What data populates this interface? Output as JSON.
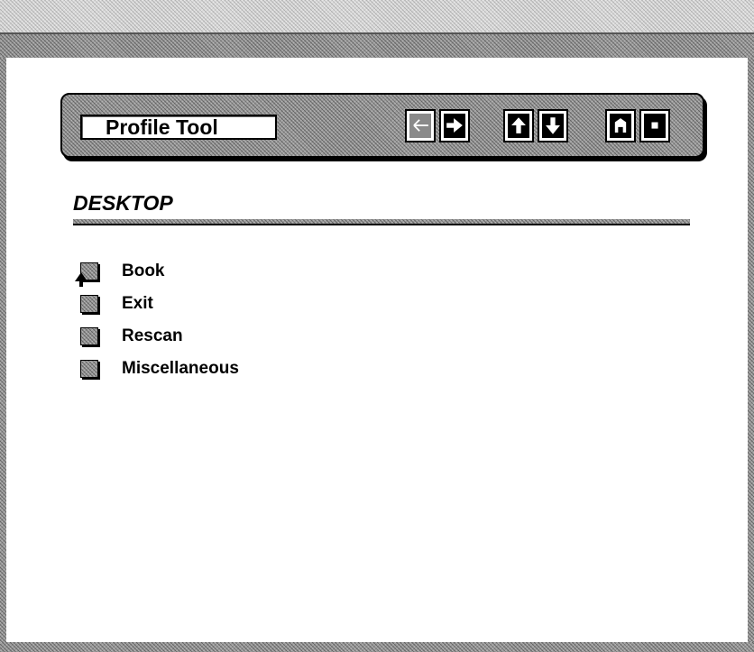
{
  "toolbar": {
    "title": "Profile Tool",
    "buttons": [
      {
        "icon": "arrow-left-icon",
        "enabled": false
      },
      {
        "icon": "arrow-right-icon",
        "enabled": true
      },
      {
        "icon": "arrow-up-icon",
        "enabled": true
      },
      {
        "icon": "arrow-down-icon",
        "enabled": true
      },
      {
        "icon": "home-icon",
        "enabled": true
      },
      {
        "icon": "stop-icon",
        "enabled": true
      }
    ]
  },
  "main": {
    "heading": "DESKTOP",
    "items": [
      {
        "label": "Book"
      },
      {
        "label": "Exit"
      },
      {
        "label": "Rescan"
      },
      {
        "label": "Miscellaneous"
      }
    ]
  },
  "colors": {
    "frame": "#9a9a9a",
    "background": "#ffffff",
    "text": "#000000"
  }
}
